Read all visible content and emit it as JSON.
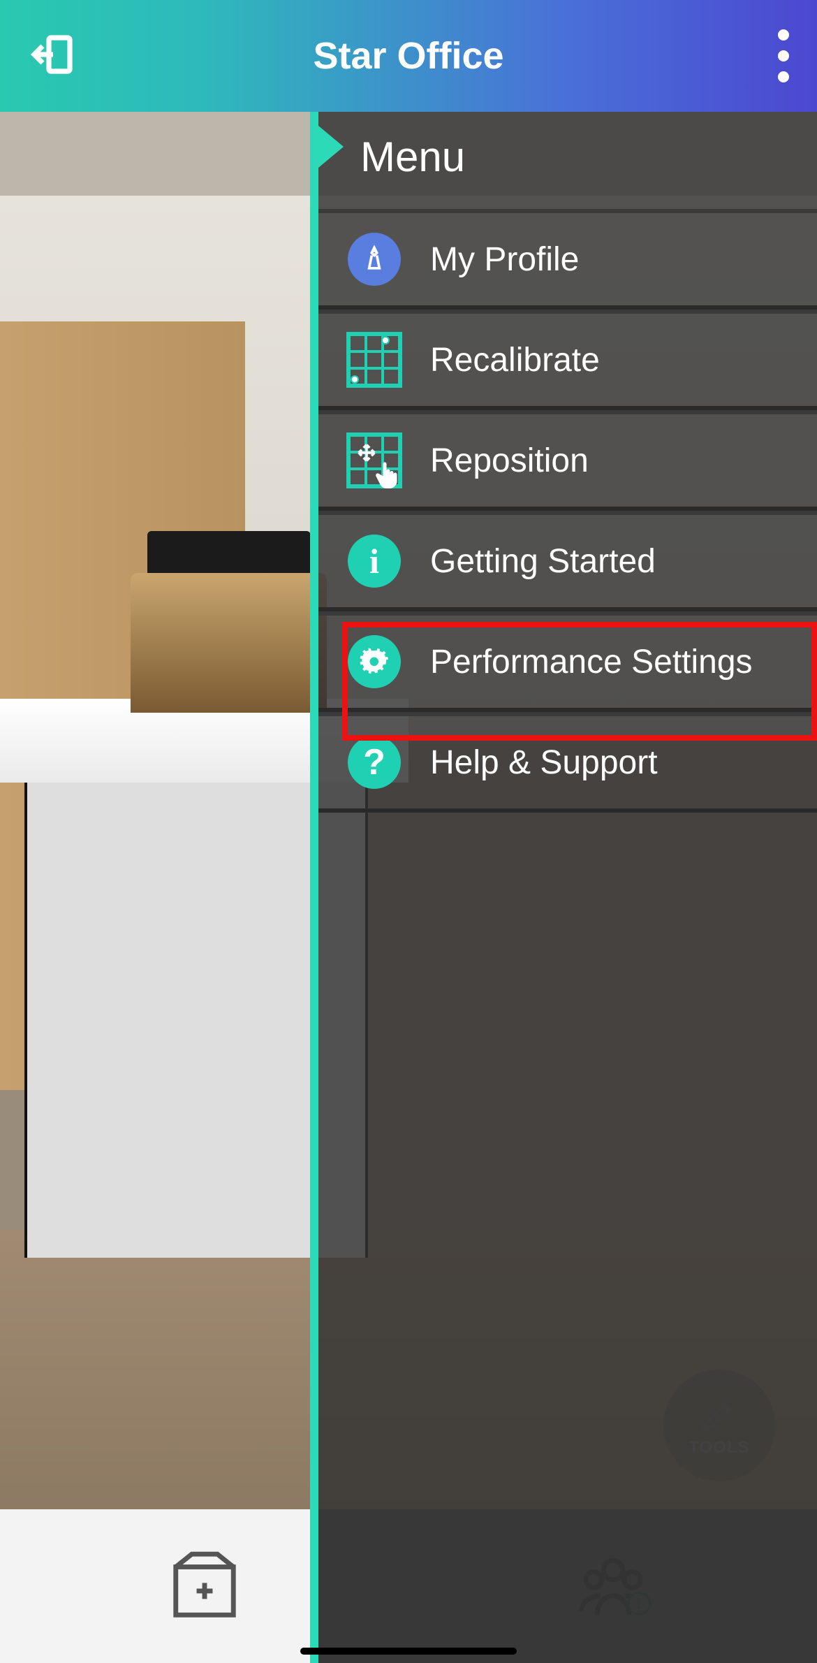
{
  "header": {
    "title": "Star Office"
  },
  "menu": {
    "title": "Menu",
    "items": [
      {
        "label": "My Profile",
        "icon": "profile"
      },
      {
        "label": "Recalibrate",
        "icon": "grid"
      },
      {
        "label": "Reposition",
        "icon": "grid-hand"
      },
      {
        "label": "Getting Started",
        "icon": "info"
      },
      {
        "label": "Performance Settings",
        "icon": "gear",
        "highlighted": true
      },
      {
        "label": "Help & Support",
        "icon": "question"
      }
    ]
  },
  "tools_fab": {
    "label": "TOOLS"
  },
  "bottombar": {
    "tabs": [
      {
        "name": "add-room"
      },
      {
        "name": "people",
        "badge": "1"
      }
    ]
  }
}
